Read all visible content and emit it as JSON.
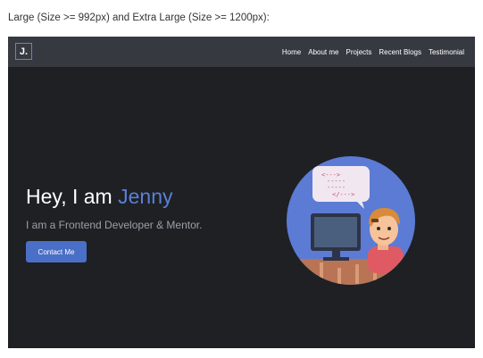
{
  "caption": "Large (Size >= 992px) and Extra Large (Size >= 1200px):",
  "navbar": {
    "logo": "J.",
    "links": [
      "Home",
      "About me",
      "Projects",
      "Recent Blogs",
      "Testimonial"
    ]
  },
  "hero": {
    "greeting": "Hey, I am ",
    "name": "Jenny",
    "subtitle": "I am a Frontend Developer & Mentor.",
    "cta_label": "Contact Me"
  },
  "illustration": {
    "code_lines": [
      "<--->",
      "-----",
      "-----",
      "</--->"
    ]
  },
  "colors": {
    "background": "#1f2024",
    "navbar": "#363a40",
    "accent": "#4a6fc7",
    "name": "#5b7fd6"
  }
}
